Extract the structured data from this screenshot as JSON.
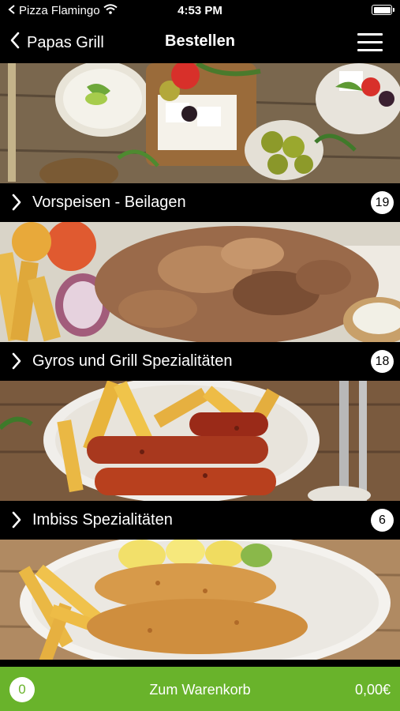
{
  "status": {
    "carrier": "Pizza Flamingo",
    "time": "4:53 PM",
    "battery_level": 1.0
  },
  "nav": {
    "back_label": "Papas Grill",
    "title": "Bestellen",
    "menu_icon": "hamburger-menu-icon"
  },
  "categories": [
    {
      "label": "Vorspeisen - Beilagen",
      "count": "19"
    },
    {
      "label": "Gyros und Grill Spezialitäten",
      "count": "18"
    },
    {
      "label": "Imbiss Spezialitäten",
      "count": "6"
    }
  ],
  "cart": {
    "item_count": "0",
    "label": "Zum Warenkorb",
    "total": "0,00€"
  },
  "colors": {
    "accent_green": "#69b32b",
    "background": "#000000"
  }
}
